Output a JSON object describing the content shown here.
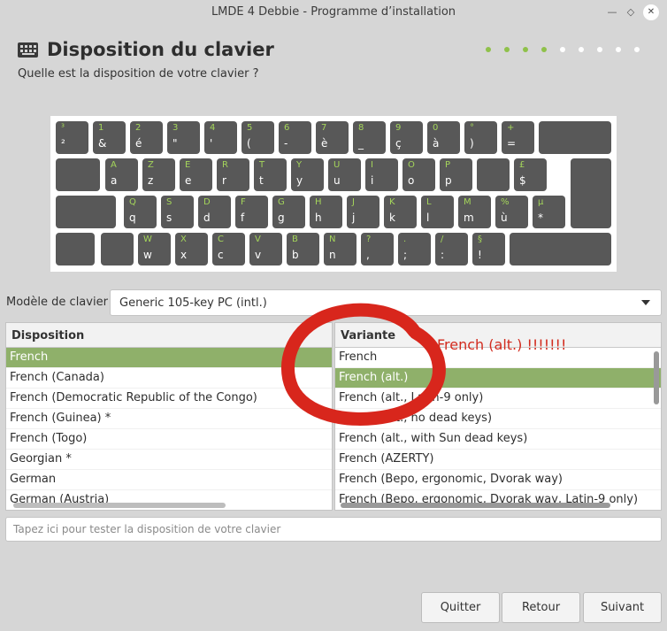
{
  "window": {
    "title": "LMDE 4 Debbie - Programme d’installation",
    "buttons": {
      "minimize": "—",
      "maximize": "◇",
      "close": "✕"
    }
  },
  "header": {
    "icon": "keyboard-icon",
    "title": "Disposition du clavier",
    "subtitle": "Quelle est la disposition de votre clavier ?"
  },
  "progress": {
    "steps_total": 9,
    "steps_done": 4,
    "accent": "#8fc14a"
  },
  "keyboard": {
    "row1": [
      {
        "top": "³",
        "bot": "²"
      },
      {
        "top": "1",
        "bot": "&"
      },
      {
        "top": "2",
        "bot": "é"
      },
      {
        "top": "3",
        "bot": "\""
      },
      {
        "top": "4",
        "bot": "'"
      },
      {
        "top": "5",
        "bot": "("
      },
      {
        "top": "6",
        "bot": "-"
      },
      {
        "top": "7",
        "bot": "è"
      },
      {
        "top": "8",
        "bot": "_"
      },
      {
        "top": "9",
        "bot": "ç"
      },
      {
        "top": "0",
        "bot": "à"
      },
      {
        "top": "°",
        "bot": ")"
      },
      {
        "top": "+",
        "bot": "="
      }
    ],
    "row2": [
      {
        "top": "A",
        "bot": "a"
      },
      {
        "top": "Z",
        "bot": "z"
      },
      {
        "top": "E",
        "bot": "e"
      },
      {
        "top": "R",
        "bot": "r"
      },
      {
        "top": "T",
        "bot": "t"
      },
      {
        "top": "Y",
        "bot": "y"
      },
      {
        "top": "U",
        "bot": "u"
      },
      {
        "top": "I",
        "bot": "i"
      },
      {
        "top": "O",
        "bot": "o"
      },
      {
        "top": "P",
        "bot": "p"
      },
      {
        "top": "",
        "bot": ""
      },
      {
        "top": "£",
        "bot": "$"
      }
    ],
    "row3": [
      {
        "top": "Q",
        "bot": "q"
      },
      {
        "top": "S",
        "bot": "s"
      },
      {
        "top": "D",
        "bot": "d"
      },
      {
        "top": "F",
        "bot": "f"
      },
      {
        "top": "G",
        "bot": "g"
      },
      {
        "top": "H",
        "bot": "h"
      },
      {
        "top": "J",
        "bot": "j"
      },
      {
        "top": "K",
        "bot": "k"
      },
      {
        "top": "L",
        "bot": "l"
      },
      {
        "top": "M",
        "bot": "m"
      },
      {
        "top": "%",
        "bot": "ù"
      },
      {
        "top": "µ",
        "bot": "*"
      }
    ],
    "row4": [
      {
        "top": "W",
        "bot": "w"
      },
      {
        "top": "X",
        "bot": "x"
      },
      {
        "top": "C",
        "bot": "c"
      },
      {
        "top": "V",
        "bot": "v"
      },
      {
        "top": "B",
        "bot": "b"
      },
      {
        "top": "N",
        "bot": "n"
      },
      {
        "top": "?",
        "bot": ","
      },
      {
        "top": ".",
        "bot": ";"
      },
      {
        "top": "/",
        "bot": ":"
      },
      {
        "top": "§",
        "bot": "!"
      }
    ]
  },
  "model": {
    "label": "Modèle de clavier :",
    "value": "Generic 105-key PC (intl.)"
  },
  "layouts": {
    "header": "Disposition",
    "items": [
      "French",
      "French (Canada)",
      "French (Democratic Republic of the Congo)",
      "French (Guinea) *",
      "French (Togo)",
      "Georgian *",
      "German",
      "German (Austria)"
    ],
    "selected": 0
  },
  "variants": {
    "header": "Variante",
    "items": [
      "French",
      "French (alt.)",
      "French (alt., Latin-9 only)",
      "French (alt., no dead keys)",
      "French (alt., with Sun dead keys)",
      "French (AZERTY)",
      "French (Bepo, ergonomic, Dvorak way)",
      "French (Bepo, ergonomic, Dvorak way, Latin-9 only)"
    ],
    "selected": 1
  },
  "test": {
    "placeholder": "Tapez ici pour tester la disposition de votre clavier"
  },
  "buttons": {
    "quit": "Quitter",
    "back": "Retour",
    "next": "Suivant"
  },
  "annotation": {
    "text": "French (alt.) !!!!!!!",
    "color": "#d22b1e"
  }
}
